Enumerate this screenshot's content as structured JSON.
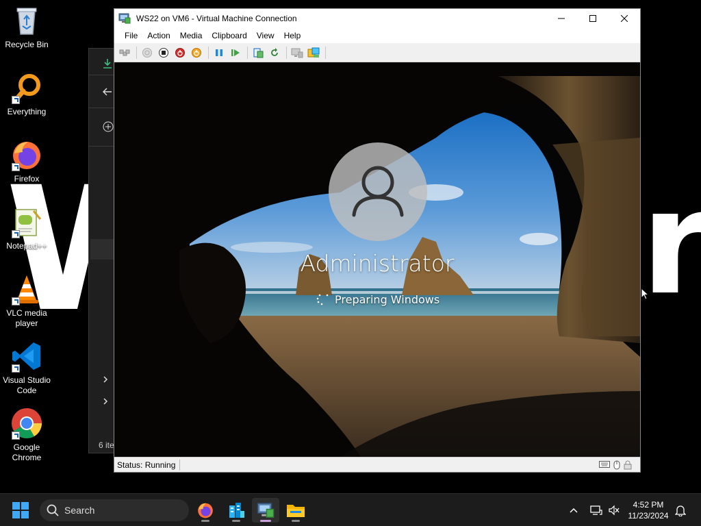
{
  "desktop": {
    "wallpaper_text": "Wi",
    "wallpaper_text_right": "r",
    "icons": [
      {
        "label": "Recycle Bin",
        "icon": "recycle-bin-icon"
      },
      {
        "label": "Everything",
        "icon": "everything-search-icon"
      },
      {
        "label": "Firefox",
        "icon": "firefox-icon"
      },
      {
        "label": "Notepad++",
        "icon": "notepad-plus-plus-icon"
      },
      {
        "label": "VLC media player",
        "icon": "vlc-icon"
      },
      {
        "label": "Visual Studio Code",
        "icon": "vscode-icon"
      },
      {
        "label": "Google Chrome",
        "icon": "chrome-icon"
      }
    ]
  },
  "explorer_bg": {
    "items_count": "6 ite"
  },
  "vm_window": {
    "title": "WS22 on VM6 - Virtual Machine Connection",
    "menu": [
      "File",
      "Action",
      "Media",
      "Clipboard",
      "View",
      "Help"
    ],
    "toolbar": [
      "ctrl-alt-del-icon",
      "start-icon",
      "turn-off-icon",
      "shutdown-icon",
      "save-icon",
      "pause-icon",
      "resume-icon",
      "checkpoint-icon",
      "revert-icon",
      "basic-session-icon",
      "enhanced-session-icon"
    ],
    "status": "Status: Running"
  },
  "login": {
    "user": "Administrator",
    "message": "Preparing Windows"
  },
  "taskbar": {
    "search_placeholder": "Search",
    "time": "4:52 PM",
    "date": "11/23/2024"
  },
  "colors": {
    "taskbar_bg": "#1c1c1c",
    "accent_blue": "#0078d4",
    "vm_chrome": "#f0f0f0"
  }
}
